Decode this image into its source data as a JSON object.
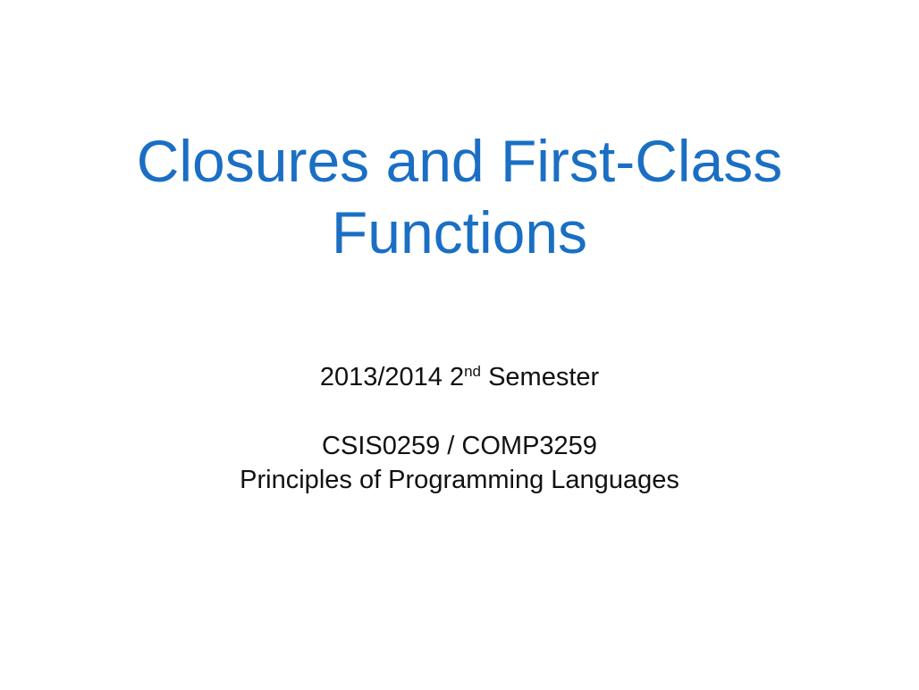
{
  "slide": {
    "title_line1": "Closures and First-Class",
    "title_line2": "Functions",
    "semester_prefix": "2013/2014 2",
    "semester_sup": "nd",
    "semester_suffix": " Semester",
    "course_code": "CSIS0259 / COMP3259",
    "course_name": "Principles of Programming Languages",
    "colors": {
      "title": "#1a6fc4",
      "text": "#111111",
      "background": "#ffffff"
    }
  }
}
